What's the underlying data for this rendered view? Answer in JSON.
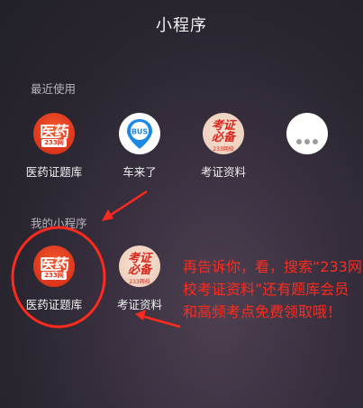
{
  "header": {
    "title": "小程序"
  },
  "recent": {
    "label": "最近使用",
    "apps": [
      {
        "name": "医药证题库",
        "icon": "yiyao-icon",
        "big": "医药",
        "sub": "233网校"
      },
      {
        "name": "车来了",
        "icon": "bus-icon",
        "text": "BUS"
      },
      {
        "name": "考证资料",
        "icon": "kaozheng-icon",
        "line1": "考证",
        "line2": "必备",
        "sub": "233网校"
      },
      {
        "name": "",
        "icon": "more-icon"
      }
    ]
  },
  "mine": {
    "label": "我的小程序",
    "apps": [
      {
        "name": "医药证题库",
        "icon": "yiyao-icon",
        "big": "医药",
        "sub": "233网校"
      },
      {
        "name": "考证资料",
        "icon": "kaozheng-icon",
        "line1": "考证",
        "line2": "必备",
        "sub": "233网校"
      }
    ]
  },
  "annotation": {
    "text": "再告诉你，看，搜索“233网校考证资料”还有题库会员和高频考点免费领取哦！",
    "color": "#ff2a1d"
  }
}
